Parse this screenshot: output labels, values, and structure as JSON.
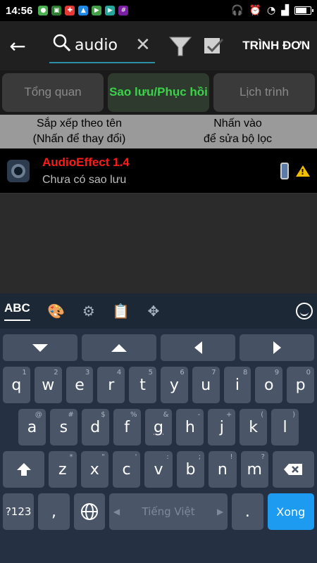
{
  "status": {
    "time": "14:56"
  },
  "toolbar": {
    "search_value": "audio",
    "menu_label": "TRÌNH ĐƠN"
  },
  "tabs": [
    {
      "label": "Tổng quan",
      "active": false
    },
    {
      "label": "Sao lưu/Phục hồi",
      "active": true
    },
    {
      "label": "Lịch trình",
      "active": false
    }
  ],
  "filterbar": {
    "sort_line1": "Sắp xếp theo tên",
    "sort_line2": "(Nhấn để thay đổi)",
    "filter_line1": "Nhấn vào",
    "filter_line2": "để sửa bộ lọc"
  },
  "list": {
    "items": [
      {
        "title": "AudioEffect 1.4",
        "subtitle": "Chưa có sao lưu"
      }
    ]
  },
  "keyboard": {
    "mode_label": "ABC",
    "row1": [
      {
        "k": "q",
        "h": "1"
      },
      {
        "k": "w",
        "h": "2"
      },
      {
        "k": "e",
        "h": "3"
      },
      {
        "k": "r",
        "h": "4"
      },
      {
        "k": "t",
        "h": "5"
      },
      {
        "k": "y",
        "h": "6"
      },
      {
        "k": "u",
        "h": "7"
      },
      {
        "k": "i",
        "h": "8"
      },
      {
        "k": "o",
        "h": "9"
      },
      {
        "k": "p",
        "h": "0"
      }
    ],
    "row2": [
      {
        "k": "a",
        "h": "@"
      },
      {
        "k": "s",
        "h": "#"
      },
      {
        "k": "d",
        "h": "$"
      },
      {
        "k": "f",
        "h": "%"
      },
      {
        "k": "g",
        "h": "&"
      },
      {
        "k": "h",
        "h": "-"
      },
      {
        "k": "j",
        "h": "+"
      },
      {
        "k": "k",
        "h": "("
      },
      {
        "k": "l",
        "h": ")"
      }
    ],
    "row3": [
      {
        "k": "z",
        "h": "*"
      },
      {
        "k": "x",
        "h": "\""
      },
      {
        "k": "c",
        "h": "'"
      },
      {
        "k": "v",
        "h": ":"
      },
      {
        "k": "b",
        "h": ";"
      },
      {
        "k": "n",
        "h": "!"
      },
      {
        "k": "m",
        "h": "?"
      }
    ],
    "sym_label": "?123",
    "comma": ",",
    "space_label": "Tiếng Việt",
    "period": ".",
    "done_label": "Xong"
  }
}
